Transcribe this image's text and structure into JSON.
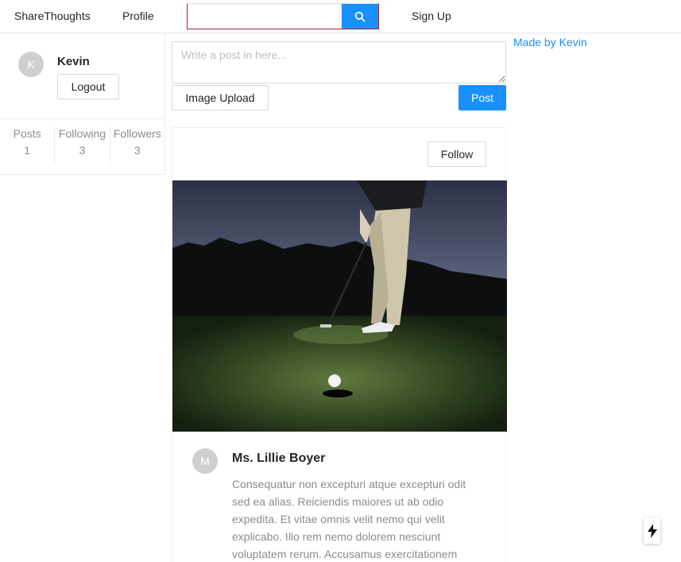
{
  "nav": {
    "brand": "ShareThoughts",
    "profile": "Profile",
    "search": {
      "value": "",
      "placeholder": "",
      "icon": "search-icon"
    },
    "signup": "Sign Up"
  },
  "sidebar": {
    "user": {
      "avatar_letter": "K",
      "name": "Kevin"
    },
    "logout_label": "Logout",
    "stats": [
      {
        "label": "Posts",
        "value": "1"
      },
      {
        "label": "Following",
        "value": "3"
      },
      {
        "label": "Followers",
        "value": "3"
      }
    ]
  },
  "composer": {
    "placeholder": "Write a post in here...",
    "upload_label": "Image Upload",
    "post_label": "Post"
  },
  "aside": {
    "credit": "Made by Kevin"
  },
  "post": {
    "follow_label": "Follow",
    "image": "golfer-putting-at-dusk",
    "author": {
      "avatar_letter": "M",
      "name": "Ms. Lillie Boyer"
    },
    "body": "Consequatur non excepturi atque excepturi odit sed ea alias. Reiciendis maiores ut ab odio expedita. Et vitae omnis velit nemo qui velit explicabo. Illo rem nemo dolorem nesciunt voluptatem rerum. Accusamus exercitationem"
  },
  "colors": {
    "primary": "#1890ff",
    "muted": "#8c8c8c",
    "avatar": "#cfcfcf"
  },
  "floating": {
    "icon": "lightning-bolt-icon"
  }
}
